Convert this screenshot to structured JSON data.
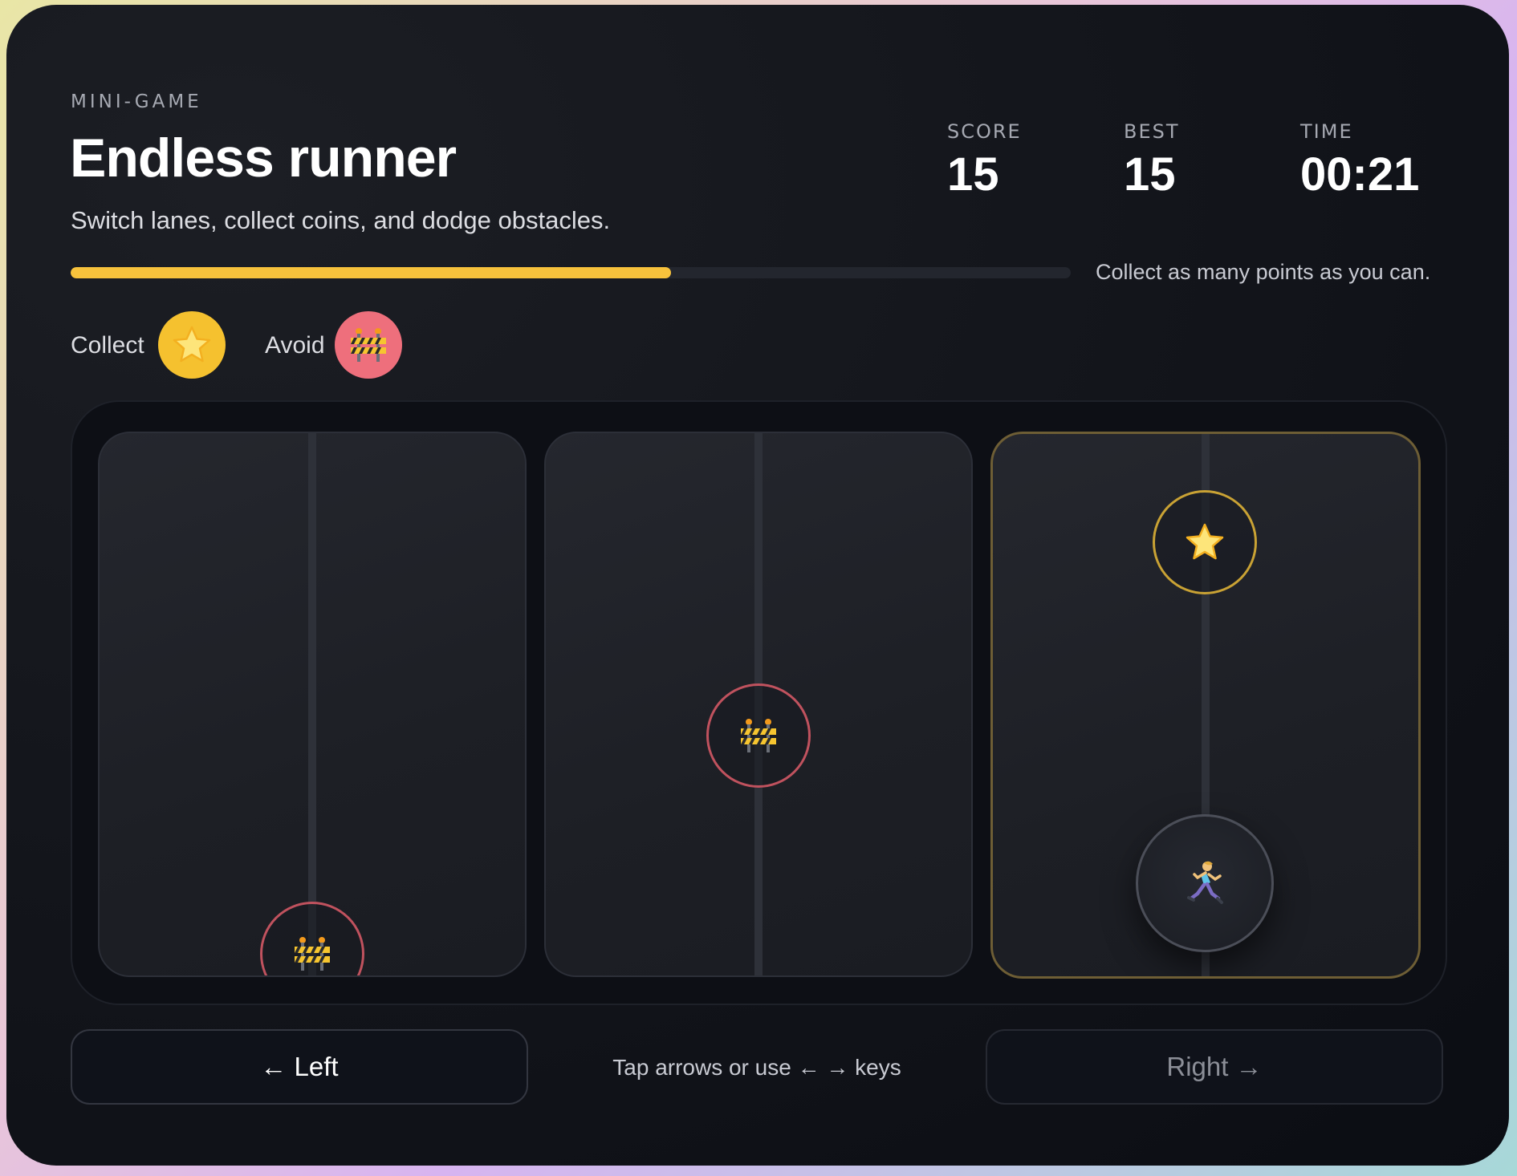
{
  "header": {
    "eyebrow": "MINI-GAME",
    "title": "Endless runner",
    "subtitle": "Switch lanes, collect coins, and dodge obstacles."
  },
  "stats": {
    "score_label": "SCORE",
    "score": "15",
    "best_label": "BEST",
    "best": "15",
    "time_label": "TIME",
    "time": "00:21"
  },
  "progress": {
    "fraction": 0.6,
    "note": "Collect as many points as you can."
  },
  "legend": {
    "collect_label": "Collect",
    "collect_icon": "star-icon",
    "avoid_label": "Avoid",
    "avoid_icon": "construction-barrier-icon"
  },
  "lanes": [
    {
      "index": 1,
      "active": false,
      "items": [
        "obstacle"
      ]
    },
    {
      "index": 2,
      "active": false,
      "items": [
        "obstacle"
      ]
    },
    {
      "index": 3,
      "active": true,
      "items": [
        "coin",
        "player"
      ]
    }
  ],
  "controls": {
    "left_label": "← Left",
    "hint": "Tap arrows or use ← → keys",
    "right_label": "Right →",
    "right_enabled": false
  },
  "colors": {
    "accent": "#f7c23c",
    "obstacle": "#ee6f7c",
    "obstacle_ring": "#c0525e",
    "coin_ring": "#c9a234",
    "active_lane_border": "#6e5e35",
    "background": "#0b0d13"
  }
}
